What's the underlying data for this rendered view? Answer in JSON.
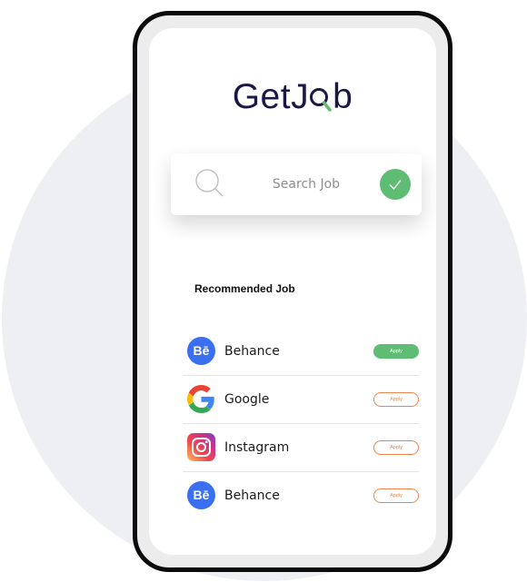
{
  "app": {
    "logo_text_before": "GetJ",
    "logo_text_after": "b"
  },
  "search": {
    "placeholder": "Search Job"
  },
  "recommended": {
    "title": "Recommended Job",
    "jobs": [
      {
        "company": "Behance",
        "icon": "behance-icon",
        "apply_label": "Apply",
        "apply_style": "filled"
      },
      {
        "company": "Google",
        "icon": "google-icon",
        "apply_label": "Apply",
        "apply_style": "outline"
      },
      {
        "company": "Instagram",
        "icon": "instagram-icon",
        "apply_label": "Apply",
        "apply_style": "outline"
      },
      {
        "company": "Behance",
        "icon": "behance-icon",
        "apply_label": "Apply",
        "apply_style": "outline"
      }
    ]
  },
  "colors": {
    "brand_dark": "#1b1846",
    "accent_green": "#5ebc73",
    "accent_orange": "#f0854b",
    "behance_blue": "#3b6ff2"
  }
}
